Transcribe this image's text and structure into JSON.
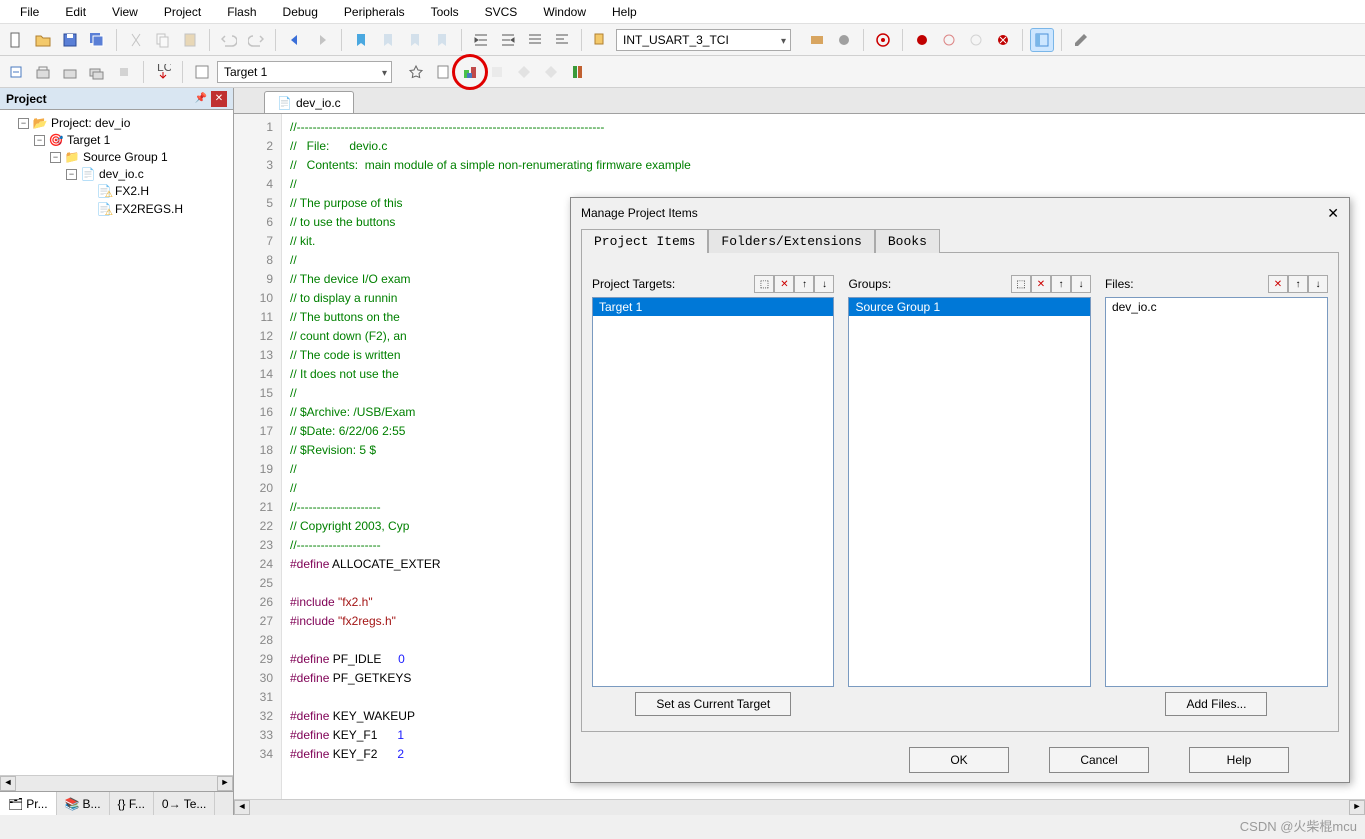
{
  "menu": [
    "File",
    "Edit",
    "View",
    "Project",
    "Flash",
    "Debug",
    "Peripherals",
    "Tools",
    "SVCS",
    "Window",
    "Help"
  ],
  "toolbar1": {
    "config_combo": "INT_USART_3_TCI"
  },
  "toolbar2": {
    "target_combo": "Target 1"
  },
  "sidebar": {
    "title": "Project",
    "tree": {
      "project": "Project: dev_io",
      "target": "Target 1",
      "group": "Source Group 1",
      "file": "dev_io.c",
      "inc1": "FX2.H",
      "inc2": "FX2REGS.H"
    },
    "tabs": [
      "Pr...",
      "B...",
      "{} F...",
      "0→ Te..."
    ]
  },
  "editor": {
    "tab": "dev_io.c",
    "lines": [
      {
        "n": 1,
        "cls": "cmt",
        "t": "//-----------------------------------------------------------------------------"
      },
      {
        "n": 2,
        "cls": "cmt",
        "t": "//   File:      devio.c"
      },
      {
        "n": 3,
        "cls": "cmt",
        "t": "//   Contents:  main module of a simple non-renumerating firmware example"
      },
      {
        "n": 4,
        "cls": "cmt",
        "t": "//"
      },
      {
        "n": 5,
        "cls": "cmt",
        "t": "// The purpose of this"
      },
      {
        "n": 6,
        "cls": "cmt",
        "t": "// to use the buttons "
      },
      {
        "n": 7,
        "cls": "cmt",
        "t": "// kit."
      },
      {
        "n": 8,
        "cls": "cmt",
        "t": "//"
      },
      {
        "n": 9,
        "cls": "cmt",
        "t": "// The device I/O exam"
      },
      {
        "n": 10,
        "cls": "cmt",
        "t": "// to display a runnin"
      },
      {
        "n": 11,
        "cls": "cmt",
        "t": "// The buttons on the "
      },
      {
        "n": 12,
        "cls": "cmt",
        "t": "// count down (F2), an"
      },
      {
        "n": 13,
        "cls": "cmt",
        "t": "// The code is written"
      },
      {
        "n": 14,
        "cls": "cmt",
        "t": "// It does not use the"
      },
      {
        "n": 15,
        "cls": "cmt",
        "t": "//"
      },
      {
        "n": 16,
        "cls": "cmt",
        "t": "// $Archive: /USB/Exam"
      },
      {
        "n": 17,
        "cls": "cmt",
        "t": "// $Date: 6/22/06 2:55"
      },
      {
        "n": 18,
        "cls": "cmt",
        "t": "// $Revision: 5 $"
      },
      {
        "n": 19,
        "cls": "cmt",
        "t": "//"
      },
      {
        "n": 20,
        "cls": "cmt",
        "t": "//"
      },
      {
        "n": 21,
        "cls": "cmt",
        "t": "//---------------------"
      },
      {
        "n": 22,
        "cls": "cmt",
        "t": "// Copyright 2003, Cyp"
      },
      {
        "n": 23,
        "cls": "cmt",
        "t": "//---------------------"
      },
      {
        "n": 24,
        "cls": "",
        "t": "#define ALLOCATE_EXTER"
      },
      {
        "n": 25,
        "cls": "",
        "t": ""
      },
      {
        "n": 26,
        "cls": "",
        "t": "#include \"fx2.h\""
      },
      {
        "n": 27,
        "cls": "",
        "t": "#include \"fx2regs.h\""
      },
      {
        "n": 28,
        "cls": "",
        "t": ""
      },
      {
        "n": 29,
        "cls": "",
        "t": "#define PF_IDLE     0"
      },
      {
        "n": 30,
        "cls": "",
        "t": "#define PF_GETKEYS"
      },
      {
        "n": 31,
        "cls": "",
        "t": ""
      },
      {
        "n": 32,
        "cls": "",
        "t": "#define KEY_WAKEUP"
      },
      {
        "n": 33,
        "cls": "",
        "t": "#define KEY_F1      1"
      },
      {
        "n": 34,
        "cls": "",
        "t": "#define KEY_F2      2"
      }
    ]
  },
  "dialog": {
    "title": "Manage Project Items",
    "tabs": [
      "Project Items",
      "Folders/Extensions",
      "Books"
    ],
    "targets": {
      "label": "Project Targets:",
      "items": [
        "Target 1"
      ],
      "button": "Set as Current Target"
    },
    "groups": {
      "label": "Groups:",
      "items": [
        "Source Group 1"
      ]
    },
    "files": {
      "label": "Files:",
      "items": [
        "dev_io.c"
      ],
      "button": "Add Files..."
    },
    "buttons": {
      "ok": "OK",
      "cancel": "Cancel",
      "help": "Help"
    }
  },
  "watermark": "CSDN @火柴棍mcu"
}
